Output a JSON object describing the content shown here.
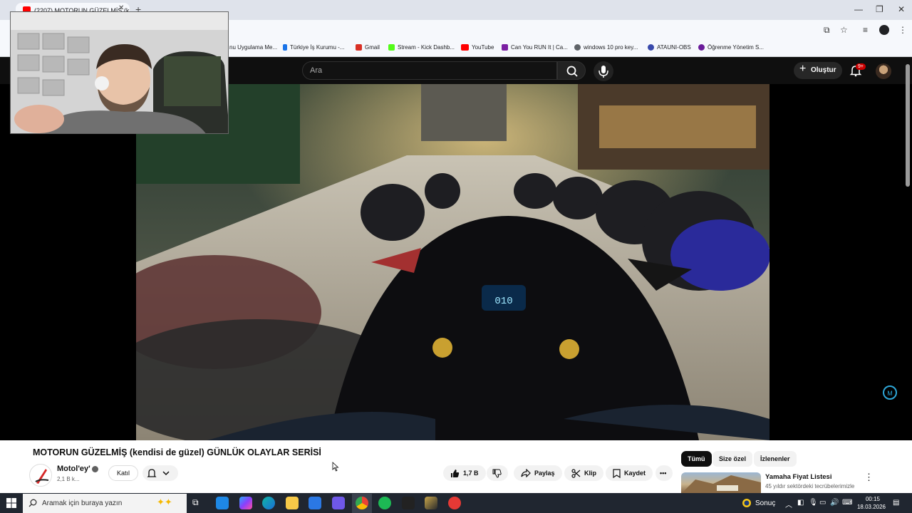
{
  "browser": {
    "tab_title": "(2207) MOTORUN GÜZELMİŞ (k",
    "bookmarks": [
      {
        "label": "nu Uygulama Me...",
        "color": "#5f6368"
      },
      {
        "label": "Türkiye İş Kurumu -...",
        "color": "#1a73e8"
      },
      {
        "label": "Gmail",
        "color": "#d93025"
      },
      {
        "label": "Stream - Kick Dashb...",
        "color": "#53fc18"
      },
      {
        "label": "YouTube",
        "color": "#ff0000"
      },
      {
        "label": "Can You RUN It | Ca...",
        "color": "#7b1fa2"
      },
      {
        "label": "windows 10 pro key...",
        "color": "#5f6368"
      },
      {
        "label": "ATAUNI-OBS",
        "color": "#3949ab"
      },
      {
        "label": "Öğrenme Yönetim S...",
        "color": "#6a1b9a"
      }
    ]
  },
  "youtube": {
    "search_placeholder": "Ara",
    "create_label": "Oluştur",
    "notification_badge": "9+",
    "video_title": "MOTORUN GÜZELMİŞ (kendisi de güzel) GÜNLÜK OLAYLAR SERİSİ",
    "channel_name": "Motol'ey'",
    "channel_subs": "2,1 B k...",
    "join_label": "Katıl",
    "like_count": "1,7 B",
    "share_label": "Paylaş",
    "clip_label": "Klip",
    "save_label": "Kaydet",
    "speedo_reading": "010",
    "chips": [
      "Tümü",
      "Size özel",
      "İzlenenler"
    ],
    "recommended": {
      "title": "Yamaha Fiyat Listesi",
      "desc": "45 yıldır sektördeki tecrübelerimizle"
    }
  },
  "taskbar": {
    "search_placeholder": "Aramak için buraya yazın",
    "weather_label": "Sonuç",
    "time": "00:15",
    "date": "18.03.2026"
  }
}
